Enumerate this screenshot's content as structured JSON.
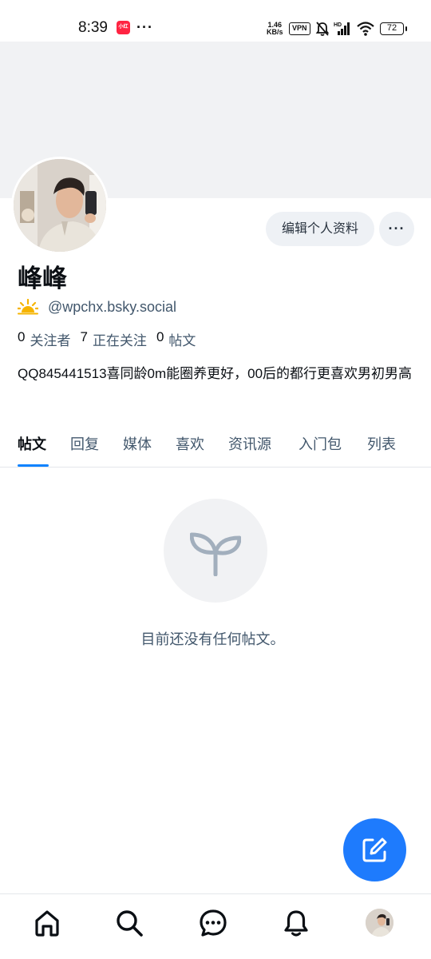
{
  "status_bar": {
    "time": "8:39",
    "app_badge": "小红书",
    "more": "···",
    "speed_value": "1.46",
    "speed_unit": "KB/s",
    "vpn": "VPN",
    "battery": "72"
  },
  "profile": {
    "display_name": "峰峰",
    "handle": "@wpchx.bsky.social",
    "edit_button": "编辑个人资料",
    "more_button": "···",
    "stats": {
      "followers_count": "0",
      "followers_label": "关注者",
      "following_count": "7",
      "following_label": "正在关注",
      "posts_count": "0",
      "posts_label": "帖文"
    },
    "bio": "QQ845441513喜同龄0m能圈养更好，00后的都行更喜欢男初男高"
  },
  "tabs": [
    "帖文",
    "回复",
    "媒体",
    "喜欢",
    "资讯源",
    "入门包",
    "列表"
  ],
  "active_tab": "帖文",
  "empty_state": {
    "icon": "sprout-icon",
    "text": "目前还没有任何帖文。"
  },
  "fab": {
    "icon": "compose-icon"
  },
  "bottom_nav": {
    "items": [
      "home-icon",
      "search-icon",
      "chat-icon",
      "bell-icon",
      "profile-avatar"
    ]
  },
  "colors": {
    "accent": "#1083fe",
    "fab": "#1e7bfd",
    "secondary_text": "#42576c",
    "banner": "#f1f2f4",
    "button_bg": "#eef1f5"
  }
}
